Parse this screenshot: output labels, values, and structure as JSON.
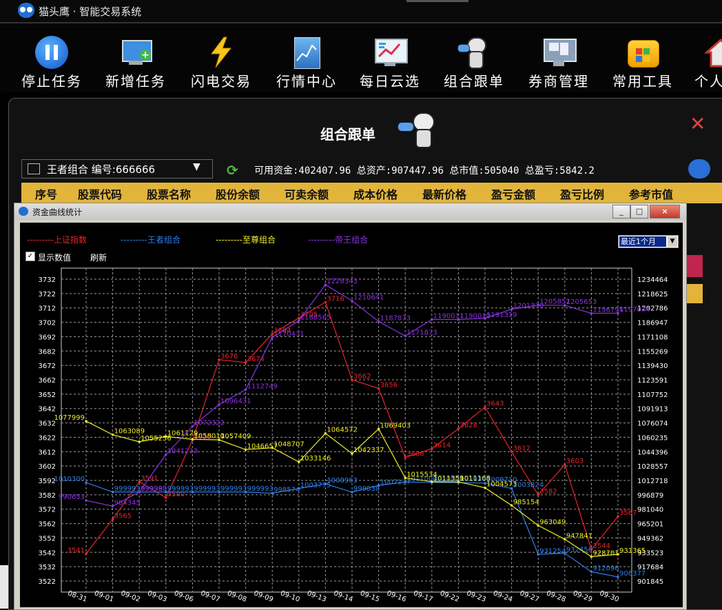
{
  "app": {
    "title": "猫头鹰 · 智能交易系统"
  },
  "toolbar": [
    {
      "label": "停止任务",
      "icon": "pause-icon"
    },
    {
      "label": "新增任务",
      "icon": "add-monitor-icon"
    },
    {
      "label": "闪电交易",
      "icon": "lightning-icon"
    },
    {
      "label": "行情中心",
      "icon": "market-chart-icon"
    },
    {
      "label": "每日云选",
      "icon": "trend-monitor-icon"
    },
    {
      "label": "组合跟单",
      "icon": "mascot-icon"
    },
    {
      "label": "券商管理",
      "icon": "broker-monitor-icon"
    },
    {
      "label": "常用工具",
      "icon": "toolbox-icon"
    },
    {
      "label": "个人",
      "icon": "home-icon"
    }
  ],
  "panel": {
    "title": "组合跟单",
    "combo_text": "王者组合 编号:666666",
    "funds_text": "可用资金:402407.96 总资产:907447.96 总市值:505040 总盈亏:5842.2",
    "columns": [
      "序号",
      "股票代码",
      "股票名称",
      "股份余额",
      "可卖余额",
      "成本价格",
      "最新价格",
      "盈亏金额",
      "盈亏比例",
      "参考市值"
    ]
  },
  "dialog": {
    "title": "资金曲线统计",
    "range": "最近1个月",
    "show_values_label": "显示数值",
    "refresh_label": "刷新",
    "min_label": "_",
    "restore_label": "□",
    "close_label": "×"
  },
  "chart_data": {
    "type": "line",
    "x": [
      "08-31",
      "09-01",
      "09-02",
      "09-03",
      "09-06",
      "09-07",
      "09-08",
      "09-09",
      "09-10",
      "09-13",
      "09-14",
      "09-15",
      "09-16",
      "09-17",
      "09-22",
      "09-23",
      "09-24",
      "09-27",
      "09-28",
      "09-29",
      "09-30"
    ],
    "left_axis": {
      "ticks": [
        3732,
        3722,
        3712,
        3702,
        3692,
        3682,
        3672,
        3662,
        3652,
        3642,
        3632,
        3622,
        3612,
        3602,
        3592,
        3582,
        3572,
        3562,
        3552,
        3542,
        3532,
        3522
      ],
      "ylim": [
        3522,
        3732
      ]
    },
    "right_axis": {
      "ticks": [
        1234464,
        1218625,
        1202786,
        1186947,
        1171108,
        1155269,
        1139430,
        1123591,
        1107752,
        1091913,
        1076074,
        1060235,
        1044396,
        1028557,
        1012718,
        996879,
        981040,
        965201,
        949362,
        933523,
        917684,
        901845
      ],
      "ylim": [
        901845,
        1234464
      ]
    },
    "series": [
      {
        "name": "上证指数",
        "axis": "left",
        "color": "#e8242c",
        "values": [
          3541,
          3565,
          3591,
          3580,
          3620,
          3676,
          3674,
          3694,
          3705,
          3716,
          3662,
          3656,
          3608,
          3614,
          3628,
          3643,
          3612,
          3582,
          3603,
          3544,
          3567
        ]
      },
      {
        "name": "王者组合",
        "axis": "right",
        "color": "#2f7fe8",
        "values": [
          1010300,
          999993,
          999993,
          999993,
          999993,
          999993,
          999993,
          998574,
          1003775,
          1008963,
          999838,
          1007137,
          1011000,
          1010500,
          1010300,
          1009710,
          1003824,
          931254,
          932456,
          912096,
          906377
        ]
      },
      {
        "name": "至尊组合",
        "axis": "right",
        "color": "#f0ee2a",
        "values": [
          1077999,
          1063089,
          1055256,
          1061129,
          1058010,
          1057409,
          1046657,
          1048707,
          1033146,
          1064572,
          1042337,
          1069403,
          1015534,
          1011359,
          1011168,
          1004573,
          985154,
          963049,
          947841,
          928701,
          931365
        ]
      },
      {
        "name": "帝王组合",
        "axis": "right",
        "color": "#8a34e0",
        "values": [
          990653,
          984345,
          999988,
          1041213,
          1072322,
          1096431,
          1112749,
          1170431,
          1188565,
          1228343,
          1210641,
          1187873,
          1171873,
          1190011,
          1190010,
          1191319,
          1201330,
          1205852,
          1205653,
          1196794,
          1197074
        ]
      }
    ],
    "grid": true,
    "legend": "top-left"
  }
}
